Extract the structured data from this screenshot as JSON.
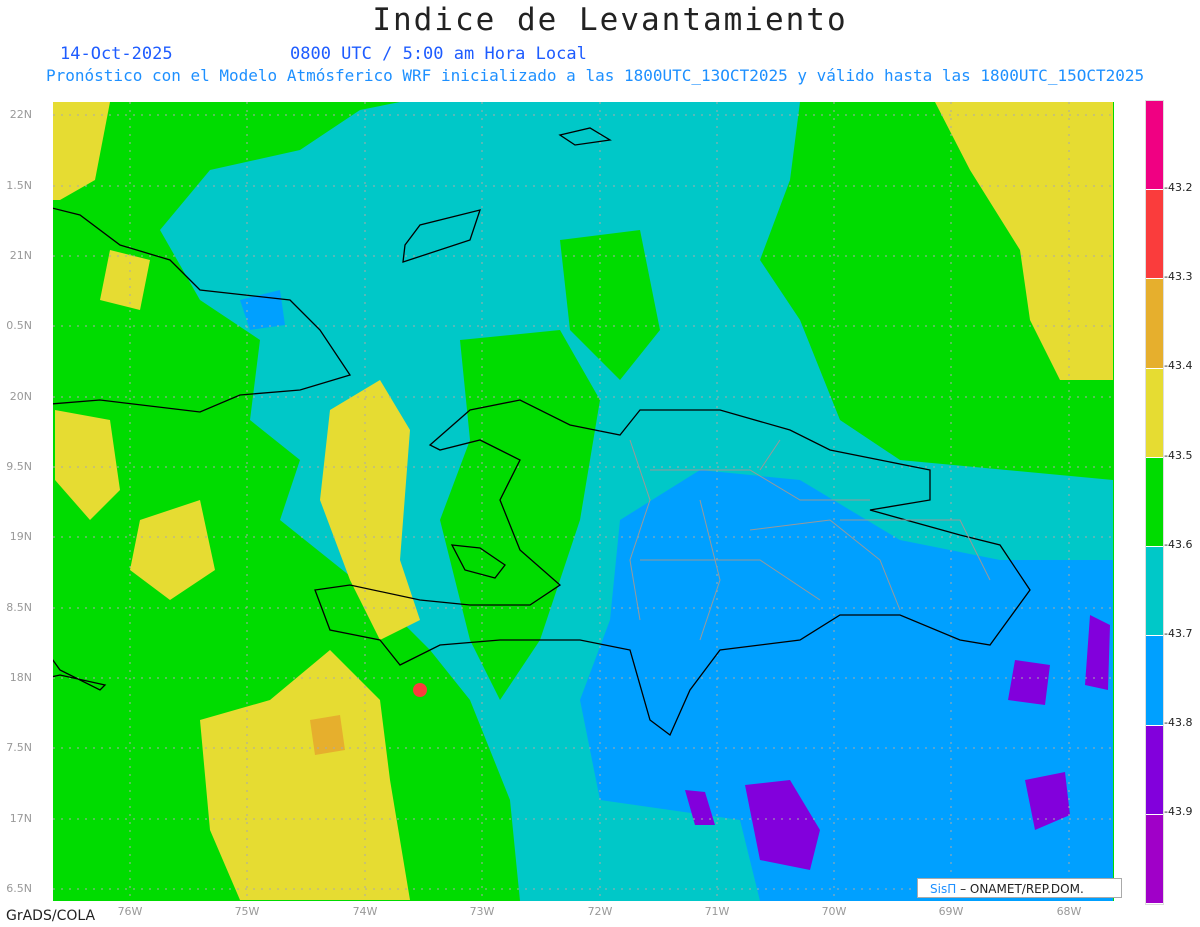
{
  "header": {
    "title": "Indice de Levantamiento",
    "date": "14-Oct-2025",
    "time": "0800 UTC / 5:00 am Hora Local",
    "subtitle": "Pronóstico con el Modelo Atmósferico WRF inicializado a las 1800UTC_13OCT2025 y válido hasta las  1800UTC_15OCT2025"
  },
  "map": {
    "lat_labels": [
      "22N",
      "1.5N",
      "21N",
      "0.5N",
      "20N",
      "9.5N",
      "19N",
      "8.5N",
      "18N",
      "7.5N",
      "17N",
      "6.5N"
    ],
    "lon_labels": [
      "76W",
      "75W",
      "74W",
      "73W",
      "72W",
      "71W",
      "70W",
      "69W",
      "68W"
    ],
    "fill_colors": {
      "yellow": "#e6dc32",
      "green": "#00dc00",
      "cyan": "#00c8c8",
      "blue": "#00a0ff",
      "purple": "#8200dc",
      "orange": "#e6af2d"
    }
  },
  "colorbar": {
    "colors": [
      "#f00082",
      "#fa3c3c",
      "#e6af2d",
      "#e6dc32",
      "#00dc00",
      "#00c8c8",
      "#00a0ff",
      "#8200dc",
      "#a000c8"
    ],
    "labels": [
      "-43.2",
      "-43.3",
      "-43.4",
      "-43.5",
      "-43.6",
      "-43.7",
      "-43.8",
      "-43.9"
    ]
  },
  "footer": {
    "left": "GrADS/COLA",
    "credit_logo": "SisΠ",
    "credit_text": "– ONAMET/REP.DOM."
  }
}
